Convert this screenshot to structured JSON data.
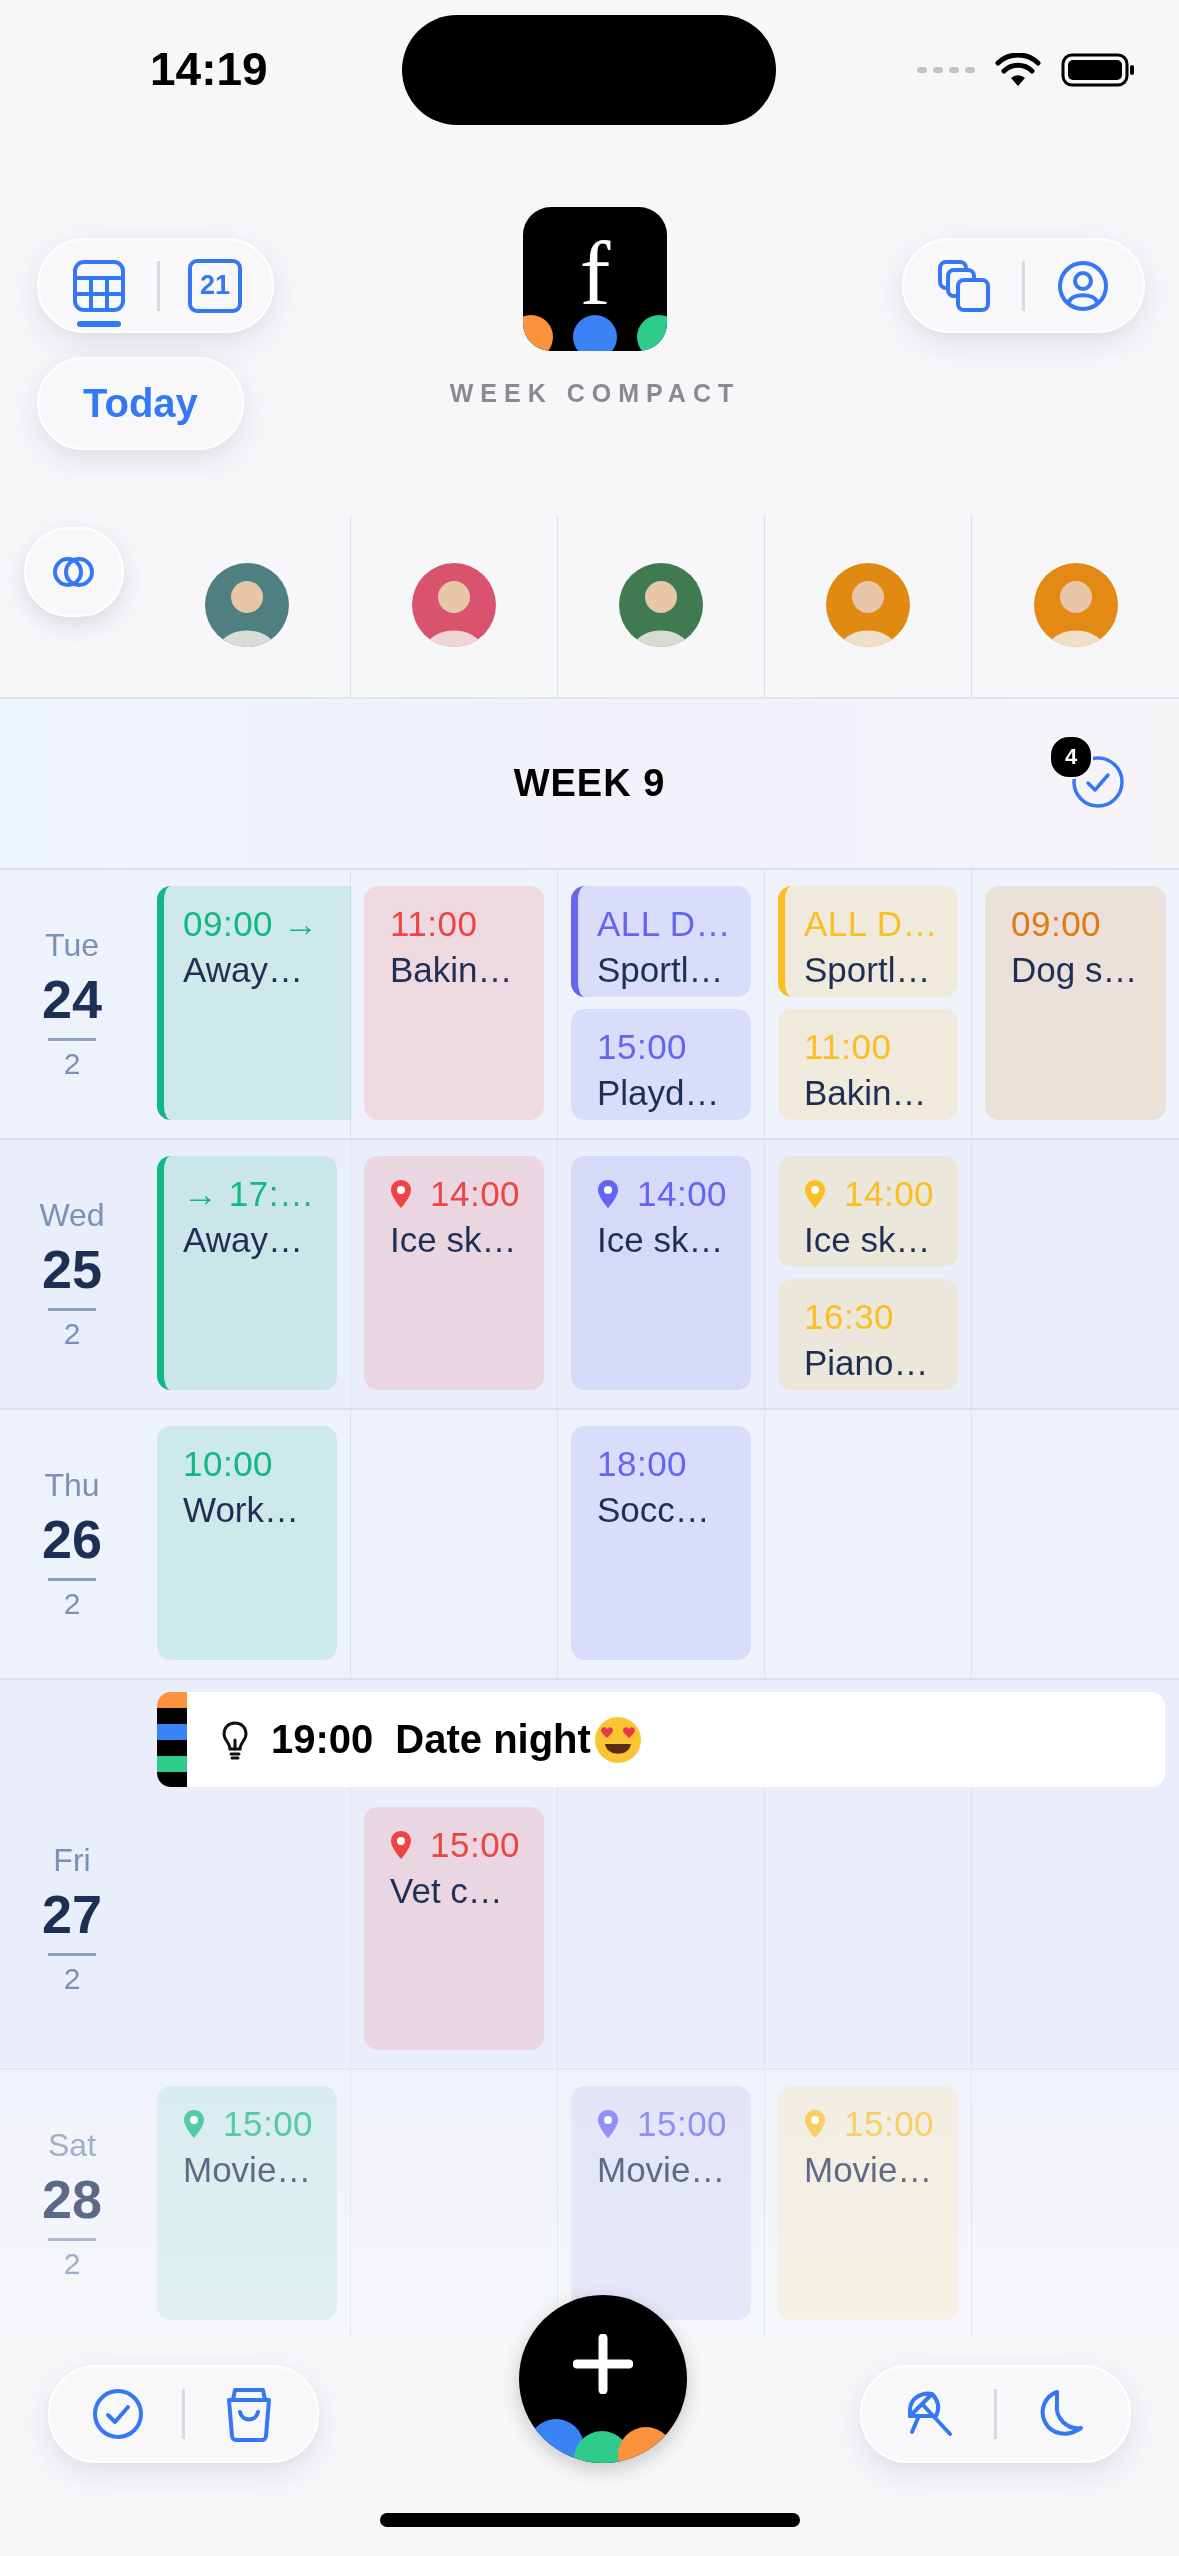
{
  "status_bar": {
    "time": "14:19"
  },
  "views": [
    {
      "kind": "grid",
      "selected": true
    },
    {
      "kind": "date",
      "label": "21",
      "selected": false
    }
  ],
  "today_button": "Today",
  "app": {
    "logo_letter": "f",
    "title": "WEEK COMPACT"
  },
  "people": [
    {
      "color": "#10b981"
    },
    {
      "color": "#ef4444"
    },
    {
      "color": "#6366f1"
    },
    {
      "color": "#fbbf24"
    },
    {
      "color": "#e07b12"
    }
  ],
  "week": {
    "title": "WEEK 9",
    "badge": "4"
  },
  "days": [
    {
      "weekday": "Tue",
      "day": "24",
      "month": "2",
      "columns": [
        [
          {
            "time": "09:00 →",
            "title": "Away…",
            "pin": false,
            "accent": true,
            "continues": true
          }
        ],
        [
          {
            "time": "11:00",
            "title": "Bakin…",
            "pin": false,
            "accent": false,
            "continues": false
          }
        ],
        [
          {
            "time": "ALL D…",
            "title": "Sportl…",
            "pin": false,
            "accent": true,
            "continues": false
          },
          {
            "time": "15:00",
            "title": "Playd…",
            "pin": false,
            "accent": false,
            "continues": false
          }
        ],
        [
          {
            "time": "ALL D…",
            "title": "Sportl…",
            "pin": false,
            "accent": true,
            "continues": false
          },
          {
            "time": "11:00",
            "title": "Bakin…",
            "pin": false,
            "accent": false,
            "continues": false
          }
        ],
        [
          {
            "time": "09:00",
            "title": "Dog s…",
            "pin": false,
            "accent": false,
            "continues": false
          }
        ]
      ]
    },
    {
      "weekday": "Wed",
      "day": "25",
      "month": "2",
      "columns": [
        [
          {
            "time": "→ 17:…",
            "title": "Away…",
            "pin": false,
            "accent": true,
            "continues": false
          }
        ],
        [
          {
            "time": "14:00",
            "title": "Ice sk…",
            "pin": true,
            "accent": false,
            "continues": false
          }
        ],
        [
          {
            "time": "14:00",
            "title": "Ice sk…",
            "pin": true,
            "accent": false,
            "continues": false
          }
        ],
        [
          {
            "time": "14:00",
            "title": "Ice sk…",
            "pin": true,
            "accent": false,
            "continues": false
          },
          {
            "time": "16:30",
            "title": "Piano…",
            "pin": false,
            "accent": false,
            "continues": false
          }
        ],
        []
      ]
    },
    {
      "weekday": "Thu",
      "day": "26",
      "month": "2",
      "columns": [
        [
          {
            "time": "10:00",
            "title": "Work…",
            "pin": false,
            "accent": false,
            "continues": false
          }
        ],
        [],
        [
          {
            "time": "18:00",
            "title": "Socc…",
            "pin": false,
            "accent": false,
            "continues": false
          }
        ],
        [],
        []
      ]
    },
    {
      "weekday": "Fri",
      "day": "27",
      "month": "2",
      "banner": {
        "time": "19:00",
        "title": "Date night"
      },
      "columns": [
        [],
        [
          {
            "time": "15:00",
            "title": "Vet c…",
            "pin": true,
            "accent": false,
            "continues": false
          }
        ],
        [],
        [],
        []
      ]
    },
    {
      "weekday": "Sat",
      "day": "28",
      "month": "2",
      "columns": [
        [
          {
            "time": "15:00",
            "title": "Movie…",
            "pin": true,
            "accent": false,
            "continues": false
          }
        ],
        [],
        [
          {
            "time": "15:00",
            "title": "Movie…",
            "pin": true,
            "accent": false,
            "continues": false
          }
        ],
        [
          {
            "time": "15:00",
            "title": "Movie…",
            "pin": true,
            "accent": false,
            "continues": false
          }
        ],
        []
      ]
    }
  ]
}
